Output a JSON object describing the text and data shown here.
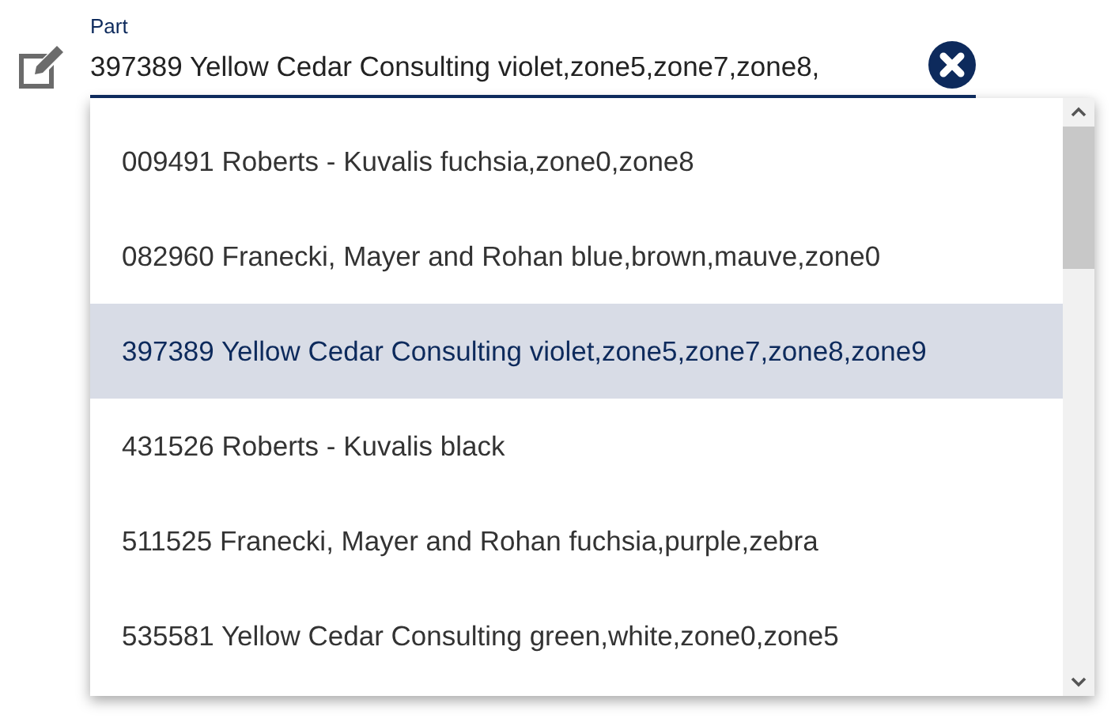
{
  "field": {
    "label": "Part",
    "value": "397389 Yellow Cedar Consulting violet,zone5,zone7,zone8,"
  },
  "options": [
    {
      "label": "009491 Roberts - Kuvalis fuchsia,zone0,zone8",
      "selected": false
    },
    {
      "label": "082960 Franecki, Mayer and Rohan blue,brown,mauve,zone0",
      "selected": false
    },
    {
      "label": "397389 Yellow Cedar Consulting violet,zone5,zone7,zone8,zone9",
      "selected": true
    },
    {
      "label": "431526 Roberts - Kuvalis black",
      "selected": false
    },
    {
      "label": "511525 Franecki, Mayer and Rohan fuchsia,purple,zebra",
      "selected": false
    },
    {
      "label": "535581 Yellow Cedar Consulting green,white,zone0,zone5",
      "selected": false
    }
  ]
}
